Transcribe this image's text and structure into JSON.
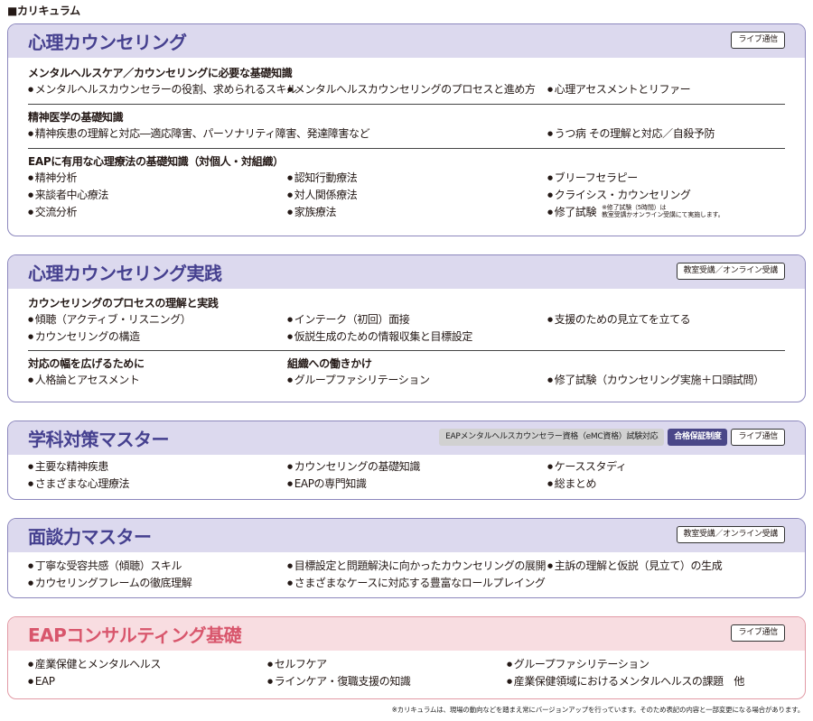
{
  "heading": "■カリキュラム",
  "cards": [
    {
      "title": "心理カウンセリング",
      "badge": "ライブ通信",
      "sections": [
        {
          "head": "メンタルヘルスケア／カウンセリングに必要な基礎知識",
          "rows": [
            [
              "メンタルヘルスカウンセラーの役割、求められるスキル",
              "メンタルヘルスカウンセリングのプロセスと進め方",
              "心理アセスメントとリファー"
            ]
          ]
        },
        {
          "head": "精神医学の基礎知識",
          "rows": [
            [
              "精神疾患の理解と対応―適応障害、パーソナリティ障害、発達障害など",
              "うつ病 その理解と対応／自殺予防"
            ]
          ]
        },
        {
          "head": "EAPに有用な心理療法の基礎知識（対個人・対組織）",
          "rows": [
            [
              "精神分析",
              "認知行動療法",
              "ブリーフセラピー"
            ],
            [
              "来談者中心療法",
              "対人関係療法",
              "クライシス・カウンセリング"
            ],
            [
              "交流分析",
              "家族療法",
              "修了試験"
            ]
          ],
          "note_line1": "※修了試験（5時間）は",
          "note_line2": "教室受講かオンライン受講にて実施します。"
        }
      ]
    },
    {
      "title": "心理カウンセリング実践",
      "badge": "教室受講／オンライン受講",
      "section1": {
        "head": "カウンセリングのプロセスの理解と実践",
        "rows": [
          [
            "傾聴（アクティブ・リスニング）",
            "インテーク（初回）面接",
            "支援のための見立てを立てる"
          ],
          [
            "カウンセリングの構造",
            "仮説生成のための情報収集と目標設定"
          ]
        ]
      },
      "section2": {
        "head1": "対応の幅を広げるために",
        "head2": "組織への働きかけ",
        "rows": [
          [
            "人格論とアセスメント",
            "グループファシリテーション",
            "修了試験（カウンセリング実施＋口頭試問）"
          ]
        ]
      }
    },
    {
      "title": "学科対策マスター",
      "badge_gray": "EAPメンタルヘルスカウンセラー資格（eMC資格）試験対応",
      "badge_navy": "合格保証制度",
      "badge": "ライブ通信",
      "rows": [
        [
          "主要な精神疾患",
          "カウンセリングの基礎知識",
          "ケーススタディ"
        ],
        [
          "さまざまな心理療法",
          "EAPの専門知識",
          "総まとめ"
        ]
      ]
    },
    {
      "title": "面談力マスター",
      "badge": "教室受講／オンライン受講",
      "rows": [
        [
          "丁寧な受容共感（傾聴）スキル",
          "目標設定と問題解決に向かったカウンセリングの展開",
          "主訴の理解と仮説（見立て）の生成"
        ],
        [
          "カウセリングフレームの徹底理解",
          "さまざまなケースに対応する豊富なロールプレイング"
        ]
      ]
    },
    {
      "title": "EAPコンサルティング基礎",
      "badge": "ライブ通信",
      "rows": [
        [
          "産業保健とメンタルヘルス",
          "セルフケア",
          "グループファシリテーション"
        ],
        [
          "EAP",
          "ラインケア・復職支援の知識",
          "産業保健領域におけるメンタルヘルスの課題　他"
        ]
      ]
    }
  ],
  "footnote": "※カリキュラムは、現場の動向などを踏まえ常にバージョンアップを行っています。そのため表記の内容と一部変更になる場合があります。"
}
